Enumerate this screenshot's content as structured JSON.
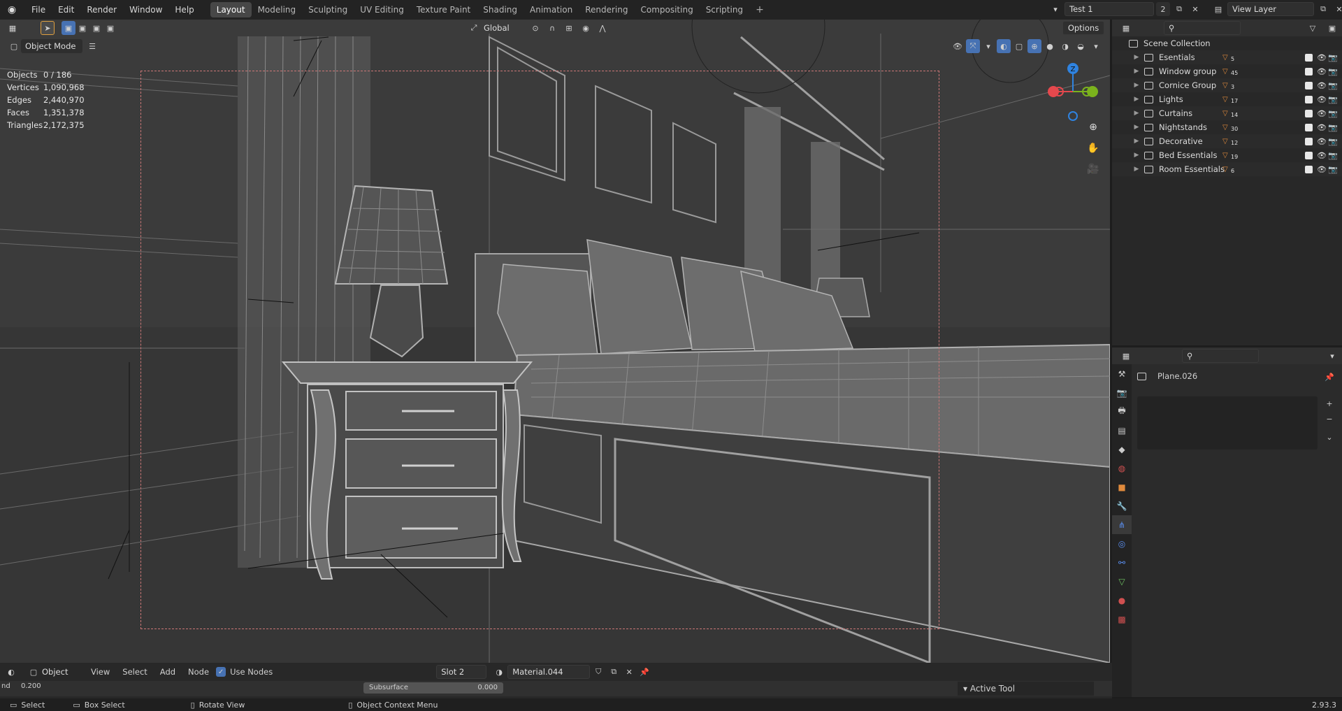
{
  "menu": [
    "File",
    "Edit",
    "Render",
    "Window",
    "Help"
  ],
  "workspaces": [
    "Layout",
    "Modeling",
    "Sculpting",
    "UV Editing",
    "Texture Paint",
    "Shading",
    "Animation",
    "Rendering",
    "Compositing",
    "Scripting"
  ],
  "active_workspace": "Layout",
  "scene": {
    "name": "Test 1",
    "users": "2"
  },
  "view_layer": "View Layer",
  "viewport": {
    "mode": "Object Mode",
    "orientation": "Global",
    "options_label": "Options",
    "gizmo_axes": {
      "x": "X",
      "y": "Y",
      "z": "Z"
    },
    "stats": [
      {
        "label": "Objects",
        "value": "0 / 186"
      },
      {
        "label": "Vertices",
        "value": "1,090,968"
      },
      {
        "label": "Edges",
        "value": "2,440,970"
      },
      {
        "label": "Faces",
        "value": "1,351,378"
      },
      {
        "label": "Triangles",
        "value": "2,172,375"
      }
    ]
  },
  "outliner": {
    "root": "Scene Collection",
    "collections": [
      {
        "name": "Esentials",
        "count": "5"
      },
      {
        "name": "Window group",
        "count": "45"
      },
      {
        "name": "Cornice Group",
        "count": "3"
      },
      {
        "name": "Lights",
        "count": "17"
      },
      {
        "name": "Curtains",
        "count": "14"
      },
      {
        "name": "Nightstands",
        "count": "30"
      },
      {
        "name": "Decorative",
        "count": "12"
      },
      {
        "name": "Bed Essentials",
        "count": "19"
      },
      {
        "name": "Room Essentials",
        "count": "6"
      }
    ]
  },
  "properties": {
    "object_name": "Plane.026"
  },
  "shader_editor": {
    "type": "Object",
    "menu": [
      "View",
      "Select",
      "Add",
      "Node"
    ],
    "use_nodes_label": "Use Nodes",
    "slot": "Slot 2",
    "material": "Material.044",
    "node_field_label": "nd",
    "node_field_value": "0.200",
    "subsurface_label": "Subsurface",
    "subsurface_value": "0.000",
    "active_tool": "Active Tool"
  },
  "statusbar": {
    "select": "Select",
    "box_select": "Box Select",
    "rotate": "Rotate View",
    "context": "Object Context Menu",
    "version": "2.93.3"
  },
  "colors": {
    "accent": "#4772b3",
    "axis_x": "#e5484d",
    "axis_y": "#7bb31d",
    "axis_z": "#2f83e0",
    "camera_frame": "#cc7777"
  }
}
